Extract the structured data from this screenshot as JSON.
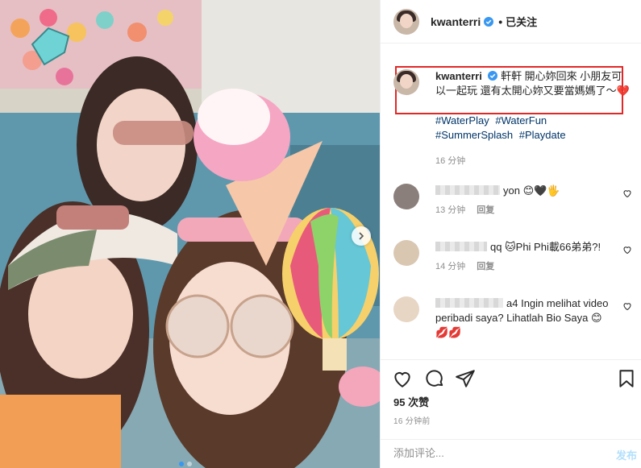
{
  "post": {
    "username": "kwanterri",
    "follow_separator": "•",
    "follow_label": "已关注",
    "caption_text": "軒軒 開心妳回來 小朋友可以一起玩 還有太開心妳又要當媽媽了～💔",
    "hashtags": [
      "#WaterPlay",
      "#WaterFun",
      "#SummerSplash",
      "#Playdate"
    ],
    "caption_time": "16 分钟",
    "comments": [
      {
        "name_tail": "yon",
        "text": "😊🖤🖐",
        "time": "13 分钟",
        "reply": "回复"
      },
      {
        "name_tail": "qq",
        "text": "🐱Phi Phi載66弟弟?!",
        "time": "14 分钟",
        "reply": "回复"
      },
      {
        "name_tail": "a4",
        "text": "Ingin melihat video peribadi saya? Lihatlah Bio Saya 😊💋💋",
        "time": "",
        "reply": ""
      }
    ],
    "likes": "95 次赞",
    "post_time": "16 分钟前",
    "comment_placeholder": "添加评论...",
    "publish_label": "发布"
  },
  "icons": {
    "like": "heart-icon",
    "comment": "comment-bubble-icon",
    "share": "paper-plane-icon",
    "save": "bookmark-icon",
    "verified": "verified-badge-icon",
    "next": "chevron-right-icon"
  },
  "colors": {
    "accent": "#3897f0",
    "highlight_box": "#e22727",
    "hashtag": "#003569",
    "muted": "#8e8e8e"
  }
}
